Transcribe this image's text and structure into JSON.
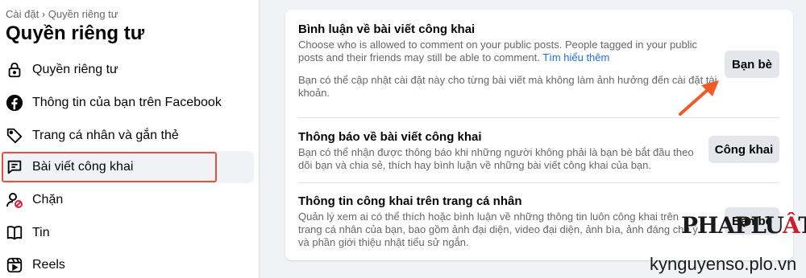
{
  "sidebar": {
    "breadcrumb": "Cài đặt › Quyền riêng tư",
    "title": "Quyền riêng tư",
    "items": [
      {
        "label": "Quyền riêng tư",
        "icon": "lock-icon"
      },
      {
        "label": "Thông tin của bạn trên Facebook",
        "icon": "facebook-icon"
      },
      {
        "label": "Trang cá nhân và gắn thẻ",
        "icon": "tag-icon"
      },
      {
        "label": "Bài viết công khai",
        "icon": "public-posts-icon",
        "active": true
      },
      {
        "label": "Chặn",
        "icon": "block-user-icon"
      },
      {
        "label": "Tin",
        "icon": "stories-icon"
      },
      {
        "label": "Reels",
        "icon": "reels-icon"
      }
    ]
  },
  "main": {
    "sections": [
      {
        "title": "Bình luận về bài viết công khai",
        "desc": "Choose who is allowed to comment on your public posts. People tagged in your public posts and their friends may still be able to comment.",
        "link": "Tìm hiểu thêm",
        "note": "Bạn có thể cập nhật cài đặt này cho từng bài viết mà không làm ảnh hưởng đến cài đặt tài khoản.",
        "button": "Bạn bè"
      },
      {
        "title": "Thông báo về bài viết công khai",
        "desc": "Bạn có thể nhận được thông báo khi những người không phải là bạn bè bắt đầu theo dõi bạn và chia sẻ, thích hay bình luận về những bài viết công khai của bạn.",
        "button": "Công khai"
      },
      {
        "title": "Thông tin công khai trên trang cá nhân",
        "desc": "Quản lý xem ai có thể thích hoặc bình luận về những thông tin luôn công khai trên trang cá nhân của bạn, bao gồm ảnh đại diện, video đại diện, ảnh bìa, ảnh đáng chú ý và phần giới thiệu nhật tiểu sử ngắn.",
        "button": "Bạn bè"
      }
    ]
  },
  "watermark": {
    "logo_main": "PHAPLU",
    "logo_accent": "Â",
    "logo_end": "T",
    "url": "kynguyenso.plo.vn"
  },
  "colors": {
    "highlight": "#e4523f",
    "link": "#216fdb",
    "button_bg": "#e4e6eb",
    "arrow": "#f05a28"
  }
}
